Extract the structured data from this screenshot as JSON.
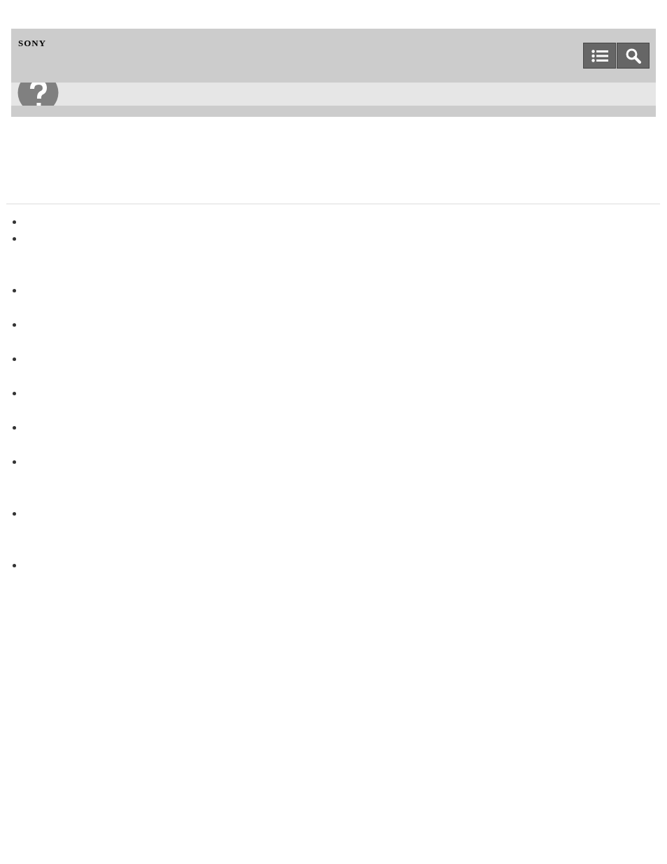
{
  "header": {
    "logo": "SONY",
    "buttons": [
      {
        "kind": "contents"
      },
      {
        "kind": "search"
      }
    ]
  },
  "list_items": [
    {
      "kind": "short"
    },
    {
      "kind": "long"
    },
    {
      "kind": "medium"
    },
    {
      "kind": "medium"
    },
    {
      "kind": "medium"
    },
    {
      "kind": "medium"
    },
    {
      "kind": "medium"
    },
    {
      "kind": "long"
    },
    {
      "kind": "long"
    },
    {
      "kind": "short"
    }
  ]
}
